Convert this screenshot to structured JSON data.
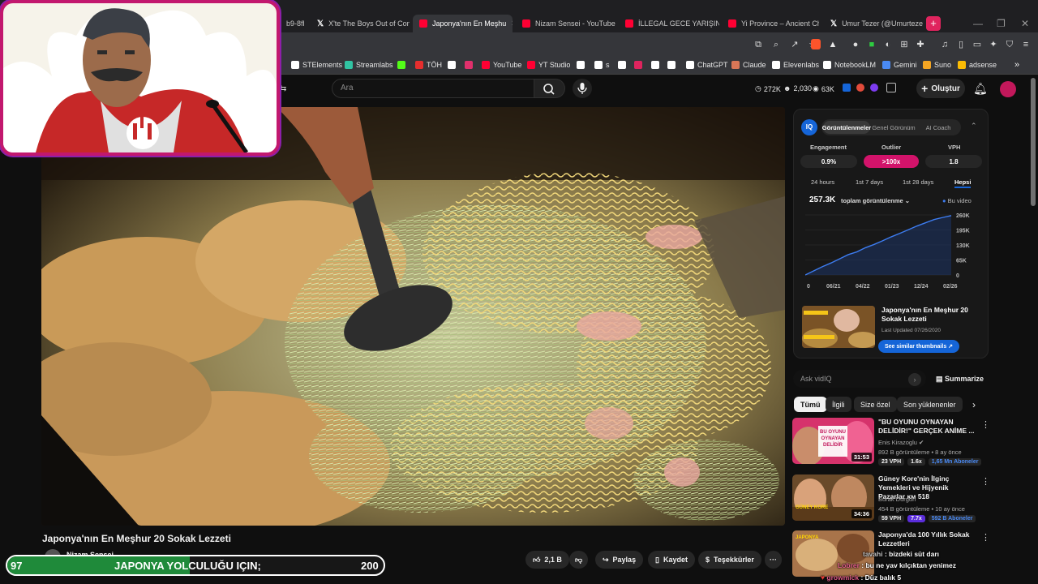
{
  "browser": {
    "tabs": [
      {
        "label": "b9-8fb",
        "icon": "generic",
        "active": false
      },
      {
        "label": "X'te The Boys Out of Conte",
        "icon": "x",
        "active": false
      },
      {
        "label": "Japonya'nın En Meşhu",
        "icon": "youtube",
        "active": true
      },
      {
        "label": "Nizam Sensei - YouTube",
        "icon": "youtube",
        "active": false
      },
      {
        "label": "İLLEGAL GECE YARIŞINA K",
        "icon": "youtube",
        "active": false
      },
      {
        "label": "Yi Province – Ancient Chin",
        "icon": "youtube",
        "active": false
      },
      {
        "label": "Umur Tezer (@Umurtezer)",
        "icon": "x",
        "active": false
      }
    ],
    "new_tab": "+",
    "window_controls": [
      "—",
      "❐",
      "✕"
    ],
    "tab_close": "✕",
    "bookmarks": [
      {
        "label": "STElements",
        "color": "#ffffff"
      },
      {
        "label": "Streamlabs",
        "color": "#31c3a2"
      },
      {
        "label": "",
        "color": "#53fc18"
      },
      {
        "label": "TÖH",
        "color": "#e62e2e"
      },
      {
        "label": "",
        "color": "#ffffff"
      },
      {
        "label": "",
        "color": "#e1306c"
      },
      {
        "label": "YouTube",
        "color": "#ff0033"
      },
      {
        "label": "YT Studio",
        "color": "#ff0033"
      },
      {
        "label": "",
        "color": "#ffffff"
      },
      {
        "label": "s",
        "color": "#ffffff"
      },
      {
        "label": "",
        "color": "#ffffff"
      },
      {
        "label": "",
        "color": "#e0245e"
      },
      {
        "label": "",
        "color": "#ffffff"
      },
      {
        "label": "",
        "color": "#ffffff"
      },
      {
        "label": "ChatGPT",
        "color": "#ffffff"
      },
      {
        "label": "Claude",
        "color": "#d97757"
      },
      {
        "label": "Elevenlabs",
        "color": "#ffffff"
      },
      {
        "label": "NotebookLM",
        "color": "#ffffff"
      },
      {
        "label": "Gemini",
        "color": "#4a8af4"
      },
      {
        "label": "Suno",
        "color": "#f5a623"
      },
      {
        "label": "adsense",
        "color": "#fbbc04"
      }
    ],
    "bookmarks_more": "»"
  },
  "youtube": {
    "search_placeholder": "Ara",
    "stats": [
      {
        "icon": "clock-icon",
        "value": "272K"
      },
      {
        "icon": "person-icon",
        "value": "2,030"
      },
      {
        "icon": "eye-icon",
        "value": "63K"
      }
    ],
    "create_label": "Oluştur"
  },
  "video": {
    "title": "Japonya'nın En Meşhur 20 Sokak Lezzeti",
    "channel": "Nizam Sensei",
    "actions": [
      {
        "label": "2,1 B",
        "icon": "thumbs-up-icon"
      },
      {
        "label": "",
        "icon": "thumbs-down-icon"
      },
      {
        "label": "Paylaş",
        "icon": "share-icon"
      },
      {
        "label": "Kaydet",
        "icon": "bookmark-icon"
      },
      {
        "label": "Teşekkürler",
        "icon": "thanks-icon"
      },
      {
        "label": "···",
        "icon": "more-icon"
      }
    ]
  },
  "goal_bar": {
    "current": "97",
    "text": "JAPONYA YOLCULUĞU IÇIN;",
    "target": "200",
    "progress": 0.485
  },
  "vidiq": {
    "logo": "IQ",
    "tabs": [
      "Görüntülenmeler",
      "Genel Görünüm",
      "AI Coach"
    ],
    "metric_labels": [
      "Engagement",
      "Outlier",
      "VPH"
    ],
    "metric_values": [
      "0.9%",
      ">100x",
      "1.8"
    ],
    "ranges": [
      "24 hours",
      "1st 7 days",
      "1st 28 days",
      "Hepsi"
    ],
    "total": "257.3K",
    "total_label": "toplam görüntülenme",
    "legend": "Bu video",
    "related_title": "Japonya'nın En Meşhur 20 Sokak Lezzeti",
    "related_meta": "Last Updated 07/26/2020",
    "similar_btn": "See similar thumbnails",
    "chart_data": {
      "type": "line",
      "x_ticks": [
        "0",
        "06/21",
        "04/22",
        "01/23",
        "12/24",
        "02/26"
      ],
      "y_ticks": [
        "0",
        "65K",
        "130K",
        "195K",
        "260K"
      ],
      "ylim": [
        0,
        260000
      ],
      "series": [
        {
          "name": "Bu video",
          "values": [
            0,
            18000,
            36000,
            52000,
            70000,
            88000,
            100000,
            118000,
            132000,
            148000,
            165000,
            180000,
            196000,
            212000,
            226000,
            240000,
            249000,
            257300
          ]
        }
      ]
    }
  },
  "ask": {
    "placeholder": "Ask vidIQ",
    "summarize": "Summarize"
  },
  "chips": [
    "Tümü",
    "İlgili",
    "Size özel",
    "Son yüklenenler"
  ],
  "recommendations": [
    {
      "title": "\"BU OYUNU OYNAYAN DELİDİR!\" GERÇEK ANİME ...",
      "channel": "Enis Kirazoglu",
      "meta": "892 B görüntüleme • 8 ay önce",
      "duration": "31:53",
      "vph": "23 VPH",
      "ratio": "1.6x",
      "subs": "1,65 Mn Aboneler",
      "thumb_text": "BU OYUNU OYNAYAN DELİDİR"
    },
    {
      "title": "Güney Kore'nin İlginç Yemekleri ve Hijyenik Pazarlar ᴋᴍ 518",
      "channel": "Burak Durgun",
      "meta": "454 B görüntüleme • 10 ay önce",
      "duration": "34:36",
      "vph": "59 VPH",
      "ratio": "7.7x",
      "subs": "592 B Aboneler",
      "thumb_text": "GÜNEY KORE"
    },
    {
      "title": "Japonya'da 100 Yıllık Sokak Lezzetleri",
      "channel": "",
      "meta": "",
      "duration": "",
      "vph": "",
      "ratio": "",
      "subs": "",
      "thumb_text": "JAPONYA"
    }
  ],
  "chat": [
    {
      "user": "tavahi",
      "text": "bizdeki süt darı"
    },
    {
      "user": "Lobrer",
      "text": "bu ne yav kılçıktan yenimez"
    },
    {
      "user": "growmick",
      "text": "Düz balık 5"
    }
  ],
  "colors": {
    "accent": "#ff0033",
    "vidiq_blue": "#1565d8",
    "outlier_pink": "#d2136a",
    "webcam_border": "#c2186e",
    "goal_green": "#1f8a3a"
  }
}
